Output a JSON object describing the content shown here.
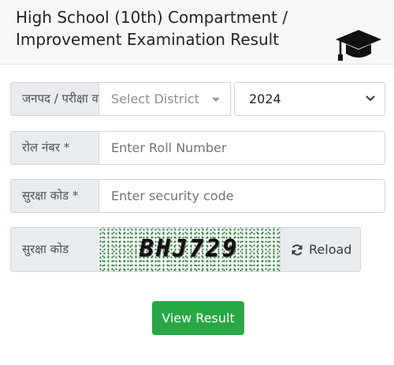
{
  "header": {
    "title": "High School (10th) Compartment / Improvement Examination Result",
    "icon": "graduation-cap-icon"
  },
  "form": {
    "district_row": {
      "label": "जनपद / परीक्षा वर्ष *",
      "district_placeholder": "Select District",
      "year_selected": "2024"
    },
    "roll_row": {
      "label": "रोल नंबर *",
      "placeholder": "Enter Roll Number"
    },
    "security_row": {
      "label": "सुरक्षा कोड *",
      "placeholder": "Enter security code"
    },
    "captcha_row": {
      "label": "सुरक्षा कोड",
      "captcha_text": "BHJ729",
      "reload_label": "Reload",
      "reload_icon": "refresh-icon"
    },
    "submit_label": "View Result"
  },
  "colors": {
    "submit_bg": "#28a745",
    "addon_bg": "#e9ecef",
    "header_bg": "#f7f7f7"
  }
}
